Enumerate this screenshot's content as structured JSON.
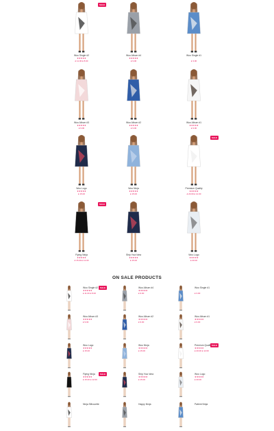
{
  "colors": {
    "accent": "#e8145a",
    "text": "#333333"
  },
  "sale_label": "SALE",
  "grid": [
    {
      "name": "Woo Single #2",
      "stars": "★★★★★",
      "price": "£ 11.00 £ 8.00",
      "sale": true
    },
    {
      "name": "Woo Album #4",
      "stars": "★★★★★",
      "price": "£ 9.00",
      "sale": false
    },
    {
      "name": "Woo Single #1",
      "stars": "",
      "price": "£ 3.00",
      "sale": false
    },
    {
      "name": "Woo Album #3",
      "stars": "★★★★★",
      "price": "£ 9.00",
      "sale": false
    },
    {
      "name": "Woo Album #2",
      "stars": "★★★★★",
      "price": "£ 9.00",
      "sale": false
    },
    {
      "name": "Woo Album #1",
      "stars": "★★★★★",
      "price": "£ 9.00",
      "sale": false
    },
    {
      "name": "Woo Logo",
      "stars": "★★★★★",
      "price": "£ 15.00",
      "sale": false
    },
    {
      "name": "Woo Ninja",
      "stars": "★★★★★",
      "price": "£ 15.00",
      "sale": false
    },
    {
      "name": "Premium Quality",
      "stars": "★★★★★",
      "price": "£ 20.00 £ 12.00",
      "sale": true
    },
    {
      "name": "Flying Ninja",
      "stars": "★★★★★",
      "price": "£ 15.00 £ 12.00",
      "sale": true
    },
    {
      "name": "Ship Your Idea",
      "stars": "★★★★★",
      "price": "£ 15.00",
      "sale": false
    },
    {
      "name": "Woo Logo",
      "stars": "★★★★★",
      "price": "£ 20.00",
      "sale": false
    }
  ],
  "section_title": "ON SALE PRODUCTS",
  "sale_list": [
    {
      "name": "Woo Single #2",
      "stars": "★★★★★",
      "price": "£ 11.00 £ 8.00",
      "sale": true
    },
    {
      "name": "Woo Album #4",
      "stars": "★★★★★",
      "price": "£ 9.00",
      "sale": false
    },
    {
      "name": "Woo Single #1",
      "stars": "",
      "price": "£ 3.00",
      "sale": false
    },
    {
      "name": "Woo Album #3",
      "stars": "★★★★★",
      "price": "£ 9.00",
      "sale": false
    },
    {
      "name": "Woo Album #2",
      "stars": "★★★★★",
      "price": "£ 9.00",
      "sale": false
    },
    {
      "name": "Woo Album #1",
      "stars": "★★★★★",
      "price": "£ 9.00",
      "sale": false
    },
    {
      "name": "Woo Logo",
      "stars": "★★★★★",
      "price": "£ 15.00",
      "sale": false
    },
    {
      "name": "Woo Ninja",
      "stars": "★★★★★",
      "price": "£ 15.00",
      "sale": false
    },
    {
      "name": "Premium Quality",
      "stars": "★★★★★",
      "price": "£ 20.00 £ 12.00",
      "sale": true
    },
    {
      "name": "Flying Ninja",
      "stars": "★★★★★",
      "price": "£ 15.00 £ 12.00",
      "sale": true
    },
    {
      "name": "Ship Your Idea",
      "stars": "★★★★★",
      "price": "£ 15.00",
      "sale": false
    },
    {
      "name": "Woo Logo",
      "stars": "★★★★★",
      "price": "£ 20.00",
      "sale": false
    },
    {
      "name": "Ninja Silhouette",
      "stars": "",
      "price": "",
      "sale": false
    },
    {
      "name": "Happy Ninja",
      "stars": "",
      "price": "",
      "sale": false
    },
    {
      "name": "Patient Ninja",
      "stars": "",
      "price": "",
      "sale": false
    }
  ]
}
